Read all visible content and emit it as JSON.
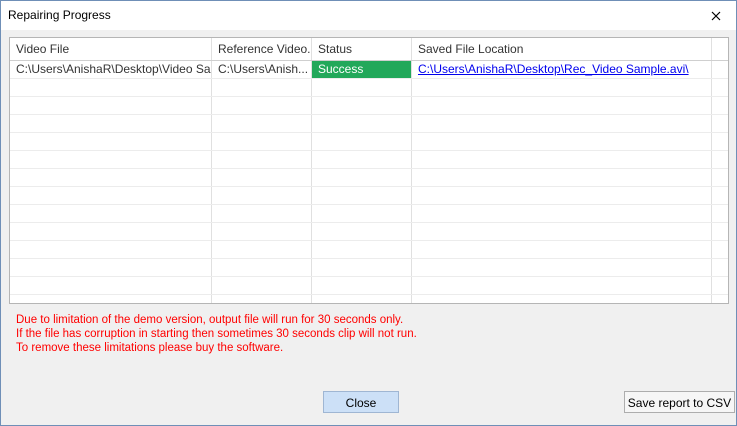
{
  "window": {
    "title": "Repairing Progress"
  },
  "table": {
    "columns": [
      "Video File",
      "Reference Video...",
      "Status",
      "Saved File Location"
    ],
    "rows": [
      {
        "video_file": "C:\\Users\\AnishaR\\Desktop\\Video Sam...",
        "reference_video": "C:\\Users\\Anish...",
        "status": "Success",
        "saved_location": "C:\\Users\\AnishaR\\Desktop\\Rec_Video Sample.avi\\"
      }
    ]
  },
  "notes": [
    "Due to limitation of the demo version, output file will run for 30 seconds only.",
    "If the file has corruption in starting then sometimes 30 seconds clip will not run.",
    "To remove these limitations please buy the software."
  ],
  "buttons": {
    "close": "Close",
    "save_csv": "Save report to CSV"
  },
  "colors": {
    "success": "#22a85a",
    "notice": "#ff0000",
    "link": "#0000ee"
  },
  "icons": {
    "close": "close-icon"
  }
}
